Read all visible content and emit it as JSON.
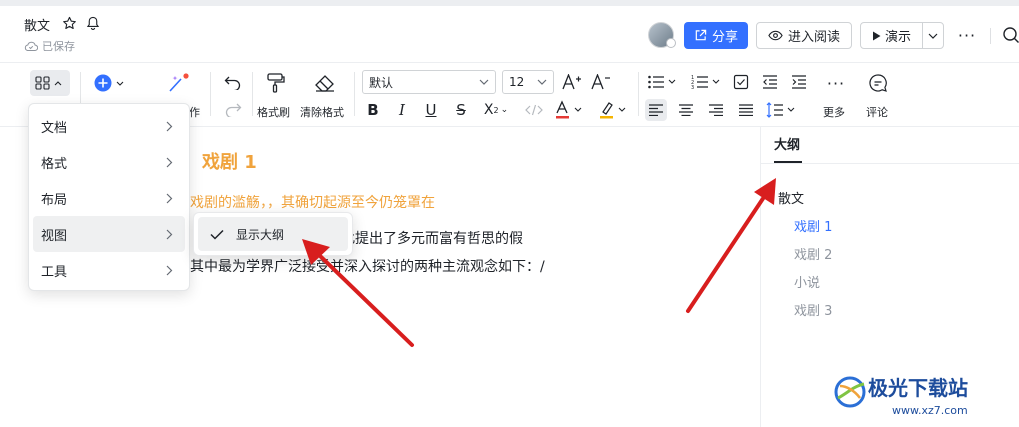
{
  "header": {
    "title": "散文",
    "saved_status": "已保存",
    "share_label": "分享",
    "read_label": "进入阅读",
    "present_label": "演示"
  },
  "toolbar": {
    "font_name": "默认",
    "font_size": "12",
    "format_painter_label": "格式刷",
    "clear_format_label": "清除格式",
    "more_label": "更多",
    "comment_label": "评论",
    "partial_label": "作"
  },
  "menu": {
    "items": [
      {
        "label": "文档"
      },
      {
        "label": "格式"
      },
      {
        "label": "布局"
      },
      {
        "label": "视图"
      },
      {
        "label": "工具"
      }
    ],
    "submenu_item": "显示大纲"
  },
  "document": {
    "heading": "戏剧 1",
    "subheading": "戏剧的滥觞，，其确切起源至今仍笼罩在",
    "para1": "术界对此提出了多元而富有哲思的假",
    "para2": "其中最为学界广泛接受并深入探讨的两种主流观念如下：/"
  },
  "outline": {
    "tab": "大纲",
    "items": [
      {
        "label": "散文"
      },
      {
        "label": "戏剧 1"
      },
      {
        "label": "戏剧 2"
      },
      {
        "label": "小说"
      },
      {
        "label": "戏剧 3"
      }
    ]
  },
  "watermark": {
    "brand": "极光下载站",
    "url": "www.xz7.com"
  },
  "colors": {
    "accent": "#3370ff",
    "heading": "#f0a33c",
    "arrow": "#d81e1e"
  }
}
